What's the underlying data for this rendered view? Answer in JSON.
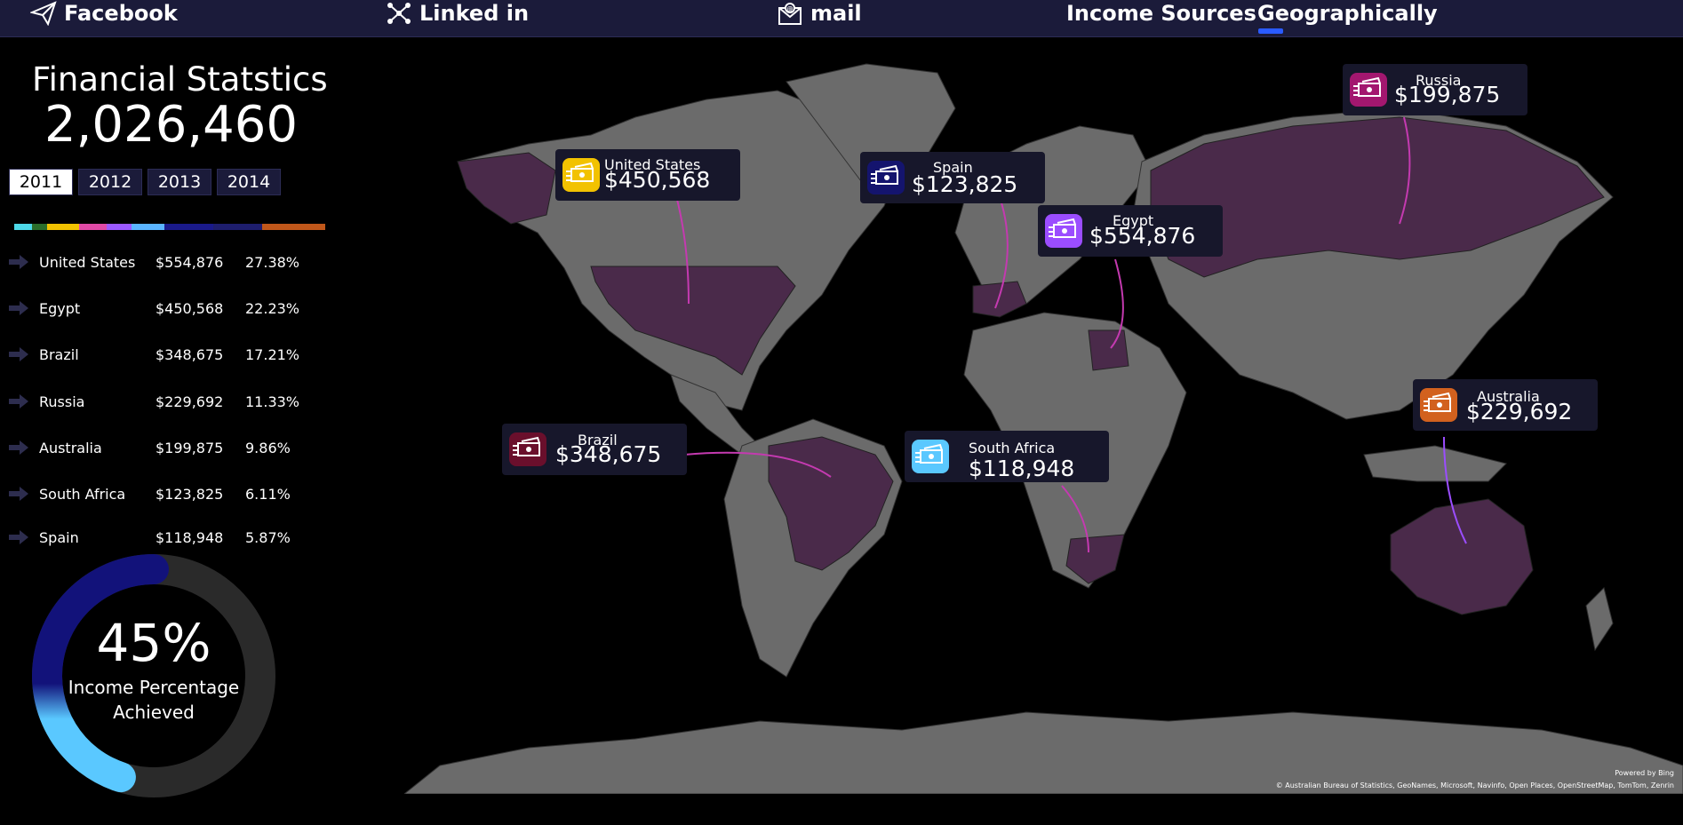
{
  "nav": {
    "facebook": "Facebook",
    "linkedin": "Linked in",
    "mail": "mail",
    "income_sources": "Income Sources",
    "geographically": "Geographically"
  },
  "header": {
    "title": "Financial Statstics",
    "total": "2,026,460"
  },
  "years": [
    "2011",
    "2012",
    "2013",
    "2014"
  ],
  "selected_year": "2011",
  "legend_colors": [
    "#4dd8e8",
    "#2b6e2b",
    "#f2c200",
    "#e14aa6",
    "#9b59ff",
    "#5ab4ff",
    "#1a1a8a",
    "#1e1e6e",
    "#c0571a"
  ],
  "countries": [
    {
      "name": "United States",
      "value": "$554,876",
      "pct": "27.38%"
    },
    {
      "name": "Egypt",
      "value": "$450,568",
      "pct": "22.23%"
    },
    {
      "name": "Brazil",
      "value": "$348,675",
      "pct": "17.21%"
    },
    {
      "name": "Russia",
      "value": "$229,692",
      "pct": "11.33%"
    },
    {
      "name": "Australia",
      "value": "$199,875",
      "pct": "9.86%"
    },
    {
      "name": "South Africa",
      "value": "$123,825",
      "pct": "6.11%"
    },
    {
      "name": "Spain",
      "value": "$118,948",
      "pct": "5.87%"
    }
  ],
  "donut": {
    "value": 0.45,
    "label_pct": "45%",
    "label_line1": "Income Percentage",
    "label_line2": "Achieved",
    "track_color": "#2a2a2a",
    "fill_color_start": "#12127a",
    "fill_color_end": "#5ac8ff"
  },
  "callouts": [
    {
      "name": "United States",
      "value": "$450,568",
      "icon_color": "#f2c200"
    },
    {
      "name": "Spain",
      "value": "$123,825",
      "icon_color": "#14146e"
    },
    {
      "name": "Egypt",
      "value": "$554,876",
      "icon_color": "#9b4dff"
    },
    {
      "name": "Russia",
      "value": "$199,875",
      "icon_color": "#a3176f"
    },
    {
      "name": "Brazil",
      "value": "$348,675",
      "icon_color": "#6a0f2c"
    },
    {
      "name": "South Africa",
      "value": "$118,948",
      "icon_color": "#5ac8ff"
    },
    {
      "name": "Australia",
      "value": "$229,692",
      "icon_color": "#d2611e"
    }
  ],
  "attribution": {
    "powered": "Powered by Bing",
    "sources": "© Australian Bureau of Statistics, GeoNames, Microsoft, Navinfo, Open Places, OpenStreetMap, TomTom, Zenrin"
  },
  "colors": {
    "land": "#6b6b6b",
    "highlight": "#4a2a4a",
    "panel": "#1b1b3a"
  }
}
